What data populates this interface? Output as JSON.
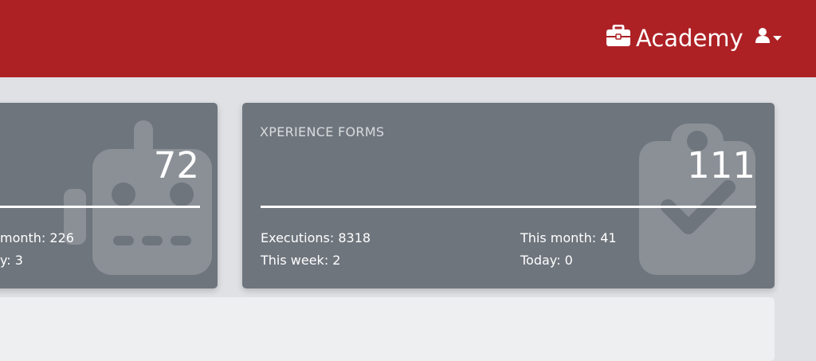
{
  "header": {
    "brand_label": "Academy",
    "brand_icon": "briefcase-icon",
    "user_icon": "user-icon",
    "dropdown_icon": "caret-down-icon",
    "background_color": "#ad2125"
  },
  "cards": [
    {
      "title": "",
      "count": "72",
      "icon": "robot-icon",
      "stats": {
        "this_month": "month: 226",
        "today": "y: 3"
      }
    },
    {
      "title": "XPERIENCE FORMS",
      "count": "111",
      "icon": "clipboard-check-icon",
      "stats": {
        "executions": "Executions: 8318",
        "this_week": "This week: 2",
        "this_month": "This month: 41",
        "today": "Today: 0"
      }
    }
  ]
}
